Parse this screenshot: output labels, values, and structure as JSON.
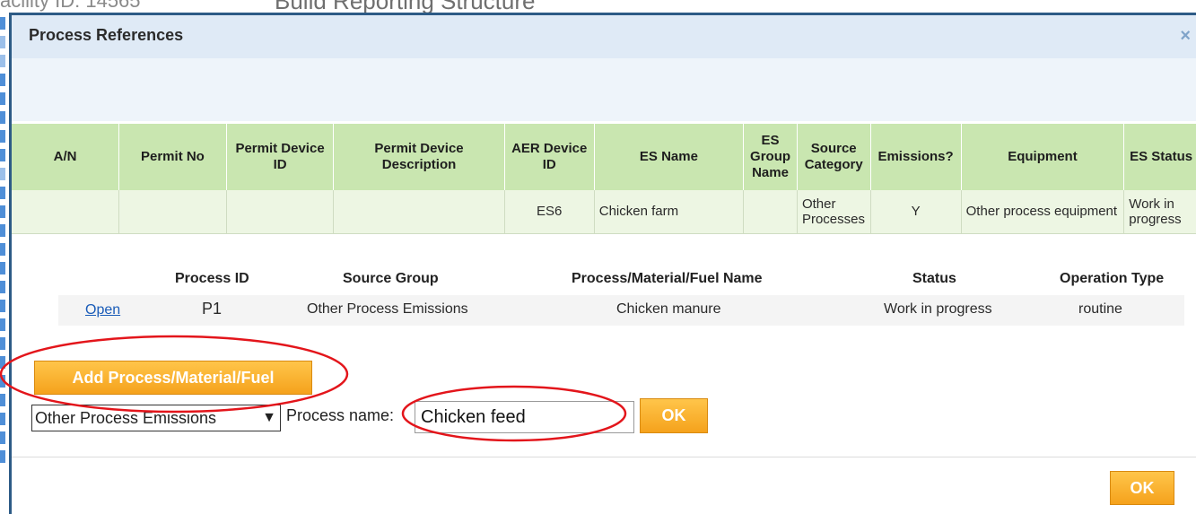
{
  "background": {
    "facility_text": "acility ID: 14565",
    "page_heading": "Build Reporting Structure"
  },
  "dialog": {
    "title": "Process References",
    "close_symbol": "×"
  },
  "ref_table": {
    "headers": [
      "A/N",
      "Permit No",
      "Permit Device ID",
      "Permit Device Description",
      "AER Device ID",
      "ES Name",
      "ES Group Name",
      "Source Category",
      "Emissions?",
      "Equipment",
      "ES Status"
    ],
    "rows": [
      [
        "",
        "",
        "",
        "",
        "ES6",
        "Chicken farm",
        "",
        "Other Processes",
        "Y",
        "Other process equipment",
        "Work in progress"
      ]
    ]
  },
  "process_table": {
    "headers": [
      "Process ID",
      "Source Group",
      "Process/Material/Fuel Name",
      "Status",
      "Operation Type"
    ],
    "rows": [
      {
        "link": "Open",
        "process_id": "P1",
        "source_group": "Other Process Emissions",
        "name": "Chicken manure",
        "status": "Work in progress",
        "operation_type": "routine"
      }
    ]
  },
  "add_form": {
    "add_button_label": "Add Process/Material/Fuel",
    "source_group_selected": "Other Process Emissions",
    "process_name_label": "Process name:",
    "process_name_value": "Chicken feed",
    "ok_label": "OK"
  },
  "footer": {
    "ok_label": "OK"
  },
  "colors": {
    "accent_orange": "#f5a21c",
    "header_green": "#c9e6b0",
    "row_green": "#edf6e3",
    "titlebar_blue": "#dfeaf6",
    "annotation_red": "#e3151b",
    "link_blue": "#1a5cb8"
  },
  "icons": {
    "close": "close-icon",
    "select": "chevron-down-icon"
  }
}
